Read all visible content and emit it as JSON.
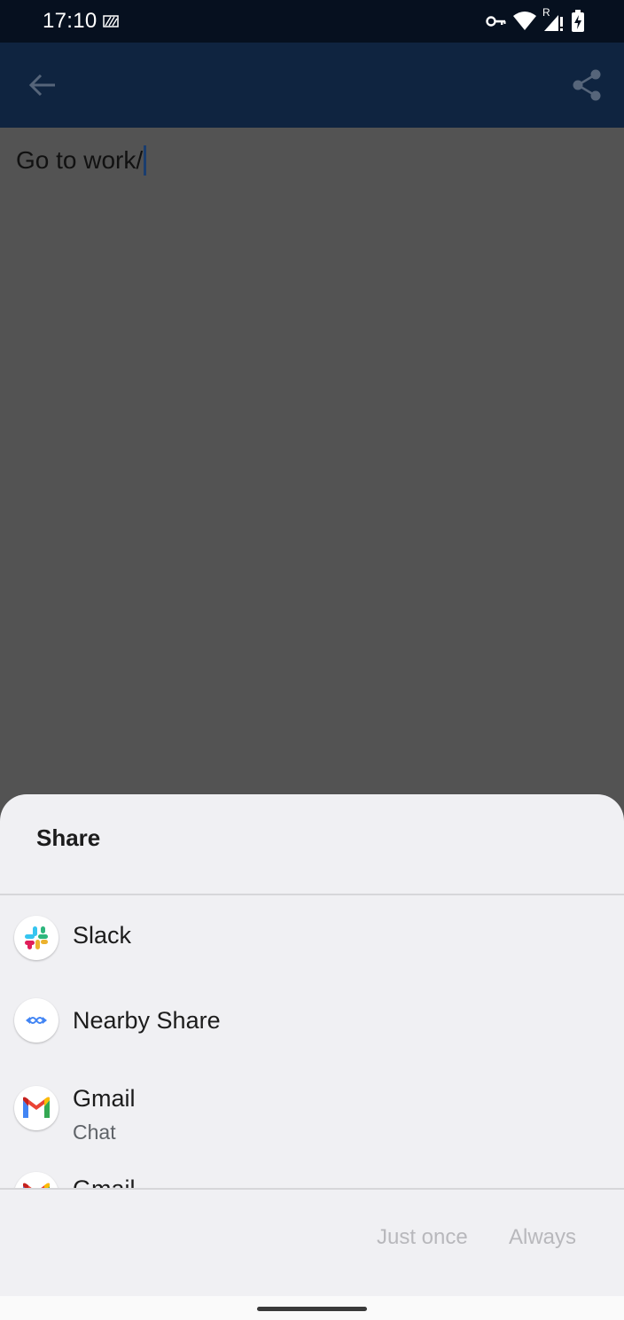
{
  "status_bar": {
    "time": "17:10",
    "roaming_label": "R",
    "icons": [
      "keyboard-stripes-icon",
      "vpn-key-icon",
      "wifi-icon",
      "cell-signal-icon",
      "battery-icon"
    ]
  },
  "app_bar": {
    "back_icon": "arrow-back-icon",
    "share_icon": "share-icon",
    "background": "#0f2440"
  },
  "content": {
    "note_text": "Go to work/"
  },
  "share_sheet": {
    "title": "Share",
    "items": [
      {
        "label": "Slack",
        "icon": "slack-icon"
      },
      {
        "label": "Nearby Share",
        "icon": "nearby-share-icon"
      },
      {
        "label": "Gmail",
        "sublabel": "Chat",
        "icon": "gmail-icon"
      },
      {
        "label": "Gmail",
        "icon": "gmail-icon"
      }
    ],
    "buttons": {
      "just_once": "Just once",
      "always": "Always"
    }
  },
  "colors": {
    "status_bar": "#06101f",
    "scrim": "#535353",
    "sheet": "#f0f0f3",
    "disabled_button_text": "#b8b8bc"
  }
}
